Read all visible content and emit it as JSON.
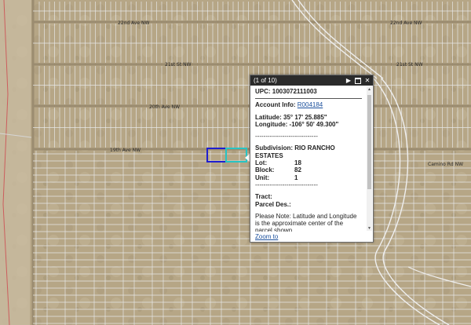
{
  "map": {
    "road_labels": [
      "22nd Ave NW",
      "21st St NW",
      "20th Ave NW",
      "19th Ave NW",
      "Camino Rd NW"
    ],
    "colors": {
      "parcel_line": "#e8e8e8",
      "selected_parcel": "#1f1fd0",
      "highlight_parcel": "#27c4c4",
      "boundary_line": "#d06060"
    }
  },
  "popup": {
    "header": "(1 of 10)",
    "controls": {
      "next": "▶",
      "maximize": "max-box",
      "close": "✕"
    },
    "upc": "UPC: 1003072111003",
    "account_label": "Account Info:",
    "account_link": "R004184",
    "latitude": "Latitude: 35° 17' 25.885\"",
    "longitude": "Longitude: -106° 50' 49.300\"",
    "separator": "------------------------------",
    "subdivision": "Subdivision: RIO RANCHO ESTATES",
    "lot_label": "Lot:",
    "lot_value": "18",
    "block_label": "Block:",
    "block_value": "82",
    "unit_label": "Unit:",
    "unit_value": "1",
    "tract": "Tract:",
    "parcel_des": "Parcel Des.:",
    "note": "Please Note: Latitude and Longitude is the approximate center of the parcel shown.",
    "zoom_to": "Zoom to"
  }
}
